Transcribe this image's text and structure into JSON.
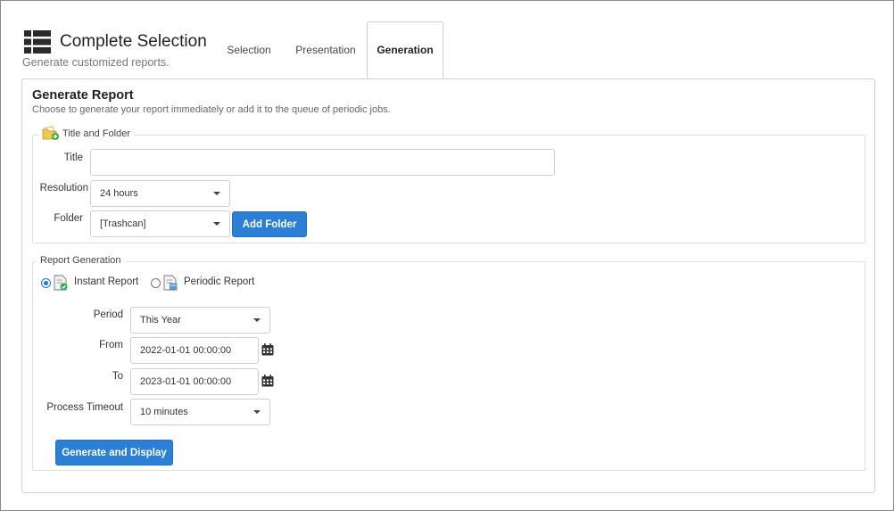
{
  "header": {
    "title": "Complete Selection",
    "subtitle": "Generate customized reports."
  },
  "tabs": [
    {
      "label": "Selection",
      "active": false
    },
    {
      "label": "Presentation",
      "active": false
    },
    {
      "label": "Generation",
      "active": true
    }
  ],
  "panel": {
    "title": "Generate Report",
    "description": "Choose to generate your report immediately or add it to the queue of periodic jobs."
  },
  "title_folder": {
    "legend": "Title and Folder",
    "title_label": "Title",
    "title_value": "",
    "resolution_label": "Resolution",
    "resolution_value": "24 hours",
    "folder_label": "Folder",
    "folder_value": "[Trashcan]",
    "add_folder_label": "Add Folder"
  },
  "report_generation": {
    "legend": "Report Generation",
    "instant_label": "Instant Report",
    "periodic_label": "Periodic Report",
    "selected": "instant",
    "period_label": "Period",
    "period_value": "This Year",
    "from_label": "From",
    "from_value": "2022-01-01 00:00:00",
    "to_label": "To",
    "to_value": "2023-01-01 00:00:00",
    "timeout_label": "Process Timeout",
    "timeout_value": "10 minutes",
    "generate_label": "Generate and Display"
  },
  "colors": {
    "accent": "#2b7fd4",
    "radio": "#1a73e8"
  }
}
